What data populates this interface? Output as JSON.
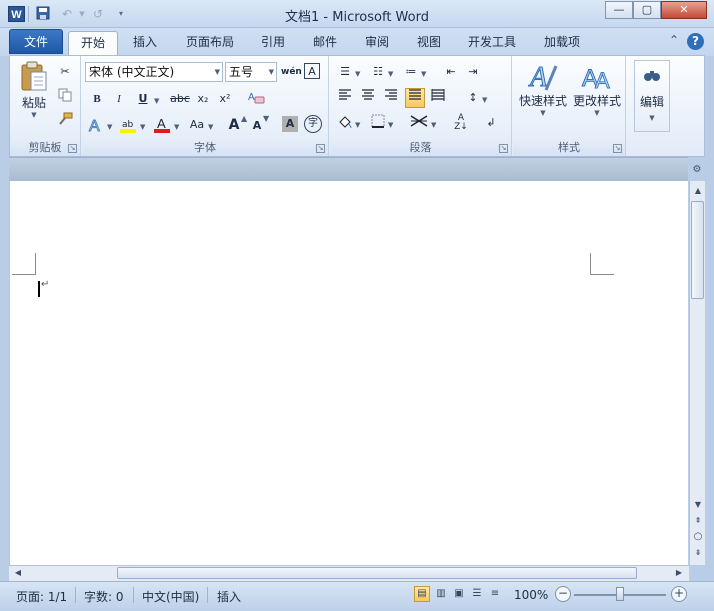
{
  "window": {
    "title": "文档1 - Microsoft Word",
    "app_icon_letter": "W",
    "buttons": {
      "minimize": "—",
      "maximize": "▢",
      "close": "✕"
    }
  },
  "quick_access": {
    "save_icon": "save-icon",
    "undo_icon": "undo-icon",
    "redo_icon": "redo-icon",
    "customize_icon": "dropdown-icon"
  },
  "tabs": [
    {
      "label": "文件"
    },
    {
      "label": "开始"
    },
    {
      "label": "插入"
    },
    {
      "label": "页面布局"
    },
    {
      "label": "引用"
    },
    {
      "label": "邮件"
    },
    {
      "label": "审阅"
    },
    {
      "label": "视图"
    },
    {
      "label": "开发工具"
    },
    {
      "label": "加载项"
    }
  ],
  "ribbon": {
    "clipboard": {
      "label": "剪贴板",
      "paste_label": "粘贴"
    },
    "font": {
      "label": "字体",
      "font_name": "宋体 (中文正文)",
      "font_size": "五号",
      "phonetic_glyph": "wén",
      "border_char": "A",
      "bold": "B",
      "italic": "I",
      "underline": "U",
      "strike": "abc",
      "subscript": "x₂",
      "superscript": "x²",
      "grow": "A",
      "shrink": "A",
      "case": "Aa",
      "shading_char": "A",
      "enclose_char": "字"
    },
    "paragraph": {
      "label": "段落"
    },
    "styles": {
      "label": "样式",
      "quick_styles": "快速样式",
      "change_styles": "更改样式"
    },
    "editing": {
      "label": "编辑"
    }
  },
  "statusbar": {
    "page": "页面: 1/1",
    "words": "字数: 0",
    "language": "中文(中国)",
    "mode": "插入",
    "zoom": "100%",
    "zoom_out": "−",
    "zoom_in": "+"
  },
  "colors": {
    "file_tab": "#2b63b0",
    "highlight": "#fff200",
    "font_color": "#e01b1b",
    "active_toggle": "#f8c95a"
  }
}
